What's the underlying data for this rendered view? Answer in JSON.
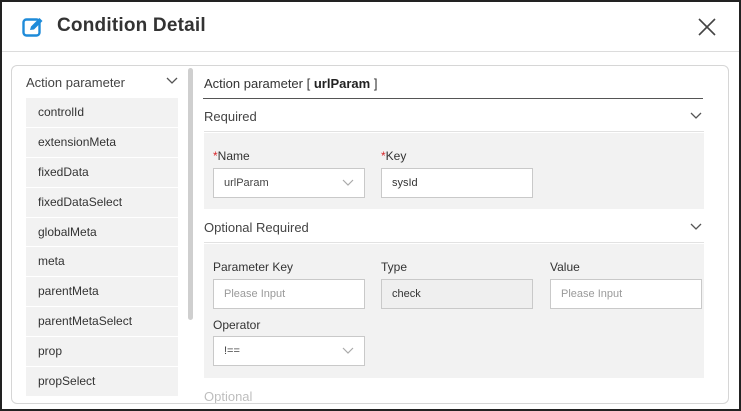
{
  "header": {
    "title": "Condition Detail"
  },
  "left_panel": {
    "header_label": "Action parameter",
    "items": [
      {
        "label": "controlId"
      },
      {
        "label": "extensionMeta"
      },
      {
        "label": "fixedData"
      },
      {
        "label": "fixedDataSelect"
      },
      {
        "label": "globalMeta"
      },
      {
        "label": "meta"
      },
      {
        "label": "parentMeta"
      },
      {
        "label": "parentMetaSelect"
      },
      {
        "label": "prop"
      },
      {
        "label": "propSelect"
      }
    ]
  },
  "right_panel": {
    "title_prefix": "Action parameter [ ",
    "title_param": "urlParam",
    "title_suffix": " ]",
    "required": {
      "label": "Required",
      "name_label": "Name",
      "name_value": "urlParam",
      "key_label": "Key",
      "key_value": "sysId"
    },
    "optional_required": {
      "label": "Optional Required",
      "param_key_label": "Parameter Key",
      "param_key_placeholder": "Please Input",
      "type_label": "Type",
      "type_value": "check",
      "value_label": "Value",
      "value_placeholder": "Please Input",
      "operator_label": "Operator",
      "operator_value": "!=="
    },
    "next_section_label": "Optional"
  },
  "colors": {
    "accent": "#1e8bd9",
    "required": "#d6262a",
    "panel_bg": "#f2f2f2"
  }
}
